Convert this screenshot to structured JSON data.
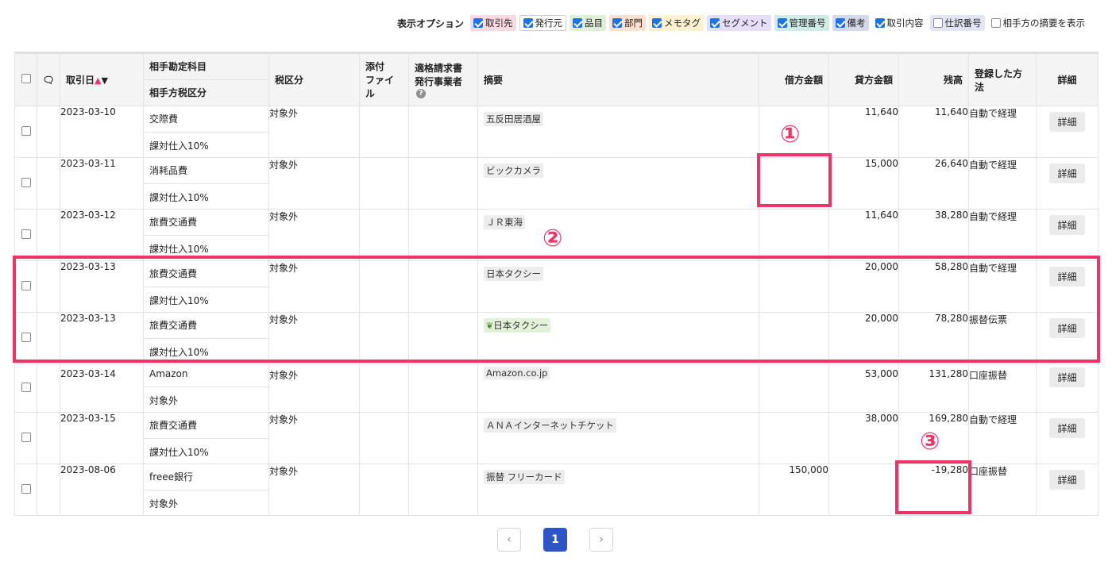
{
  "options": {
    "title": "表示オプション",
    "items": [
      {
        "label": "取引先",
        "checked": true,
        "bg": "#fbd9e2"
      },
      {
        "label": "発行元",
        "checked": true,
        "bg": "#ffffff"
      },
      {
        "label": "品目",
        "checked": true,
        "bg": "#e0f0d8"
      },
      {
        "label": "部門",
        "checked": true,
        "bg": "#fde0cf"
      },
      {
        "label": "メモタグ",
        "checked": true,
        "bg": "#fcf2cf"
      },
      {
        "label": "セグメント",
        "checked": true,
        "bg": "#e6defa"
      },
      {
        "label": "管理番号",
        "checked": true,
        "bg": "#cfece8"
      },
      {
        "label": "備考",
        "checked": true,
        "bg": "#d5d9ec"
      },
      {
        "label": "取引内容",
        "checked": true,
        "bg": "#ffffff"
      },
      {
        "label": "仕訳番号",
        "checked": false,
        "bg": "#e2e6f4"
      },
      {
        "label": "相手方の摘要を表示",
        "checked": false,
        "bg": "#ffffff"
      }
    ]
  },
  "headers": {
    "date": "取引日",
    "account": "相手勘定科目",
    "tax_class": "相手方税区分",
    "tax": "税区分",
    "attach_1": "添付",
    "attach_2": "ファイル",
    "invoice_1": "適格請求書",
    "invoice_2": "発行事業者",
    "summary": "摘要",
    "debit": "借方金額",
    "credit": "貸方金額",
    "balance": "残高",
    "registered_1": "登録した方",
    "registered_2": "法",
    "detail": "詳細"
  },
  "rows": [
    {
      "date": "2023-03-10",
      "account": "交際費",
      "tax_class": "課対仕入10%",
      "tax": "対象外",
      "summary": "五反田居酒屋",
      "debit": "",
      "credit": "11,640",
      "balance": "11,640",
      "method": "自動で経理",
      "detail": "詳細"
    },
    {
      "date": "2023-03-11",
      "account": "消耗品費",
      "tax_class": "課対仕入10%",
      "tax": "対象外",
      "summary": "ビックカメラ",
      "debit": "",
      "credit": "15,000",
      "balance": "26,640",
      "method": "自動で経理",
      "detail": "詳細"
    },
    {
      "date": "2023-03-12",
      "account": "旅費交通費",
      "tax_class": "課対仕入10%",
      "tax": "対象外",
      "summary": "ＪＲ東海",
      "debit": "",
      "credit": "11,640",
      "balance": "38,280",
      "method": "自動で経理",
      "detail": "詳細"
    },
    {
      "date": "2023-03-13",
      "account": "旅費交通費",
      "tax_class": "課対仕入10%",
      "tax": "対象外",
      "summary": "日本タクシー",
      "debit": "",
      "credit": "20,000",
      "balance": "58,280",
      "method": "自動で経理",
      "detail": "詳細"
    },
    {
      "date": "2023-03-13",
      "account": "旅費交通費",
      "tax_class": "課対仕入10%",
      "tax": "対象外",
      "summary": "日本タクシー",
      "debit": "",
      "credit": "20,000",
      "balance": "78,280",
      "method": "振替伝票",
      "detail": "詳細"
    },
    {
      "date": "2023-03-14",
      "account": "Amazon",
      "tax_class": "対象外",
      "tax": "対象外",
      "summary": "Amazon.co.jp",
      "debit": "",
      "credit": "53,000",
      "balance": "131,280",
      "method": "口座振替",
      "detail": "詳細"
    },
    {
      "date": "2023-03-15",
      "account": "旅費交通費",
      "tax_class": "課対仕入10%",
      "tax": "対象外",
      "summary": "ＡＮＡインターネットチケット",
      "debit": "",
      "credit": "38,000",
      "balance": "169,280",
      "method": "自動で経理",
      "detail": "詳細"
    },
    {
      "date": "2023-08-06",
      "account": "freee銀行",
      "tax_class": "対象外",
      "tax": "対象外",
      "summary": "振替 フリーカード",
      "debit": "150,000",
      "credit": "",
      "balance": "-19,280",
      "method": "口座振替",
      "detail": "詳細"
    }
  ],
  "annotations": {
    "one": "①",
    "two": "②",
    "three": "③"
  },
  "pagination": {
    "prev": "‹",
    "current": "1",
    "next": "›"
  },
  "colors": {
    "accent": "#ee3366",
    "page_active": "#2f54c8"
  }
}
